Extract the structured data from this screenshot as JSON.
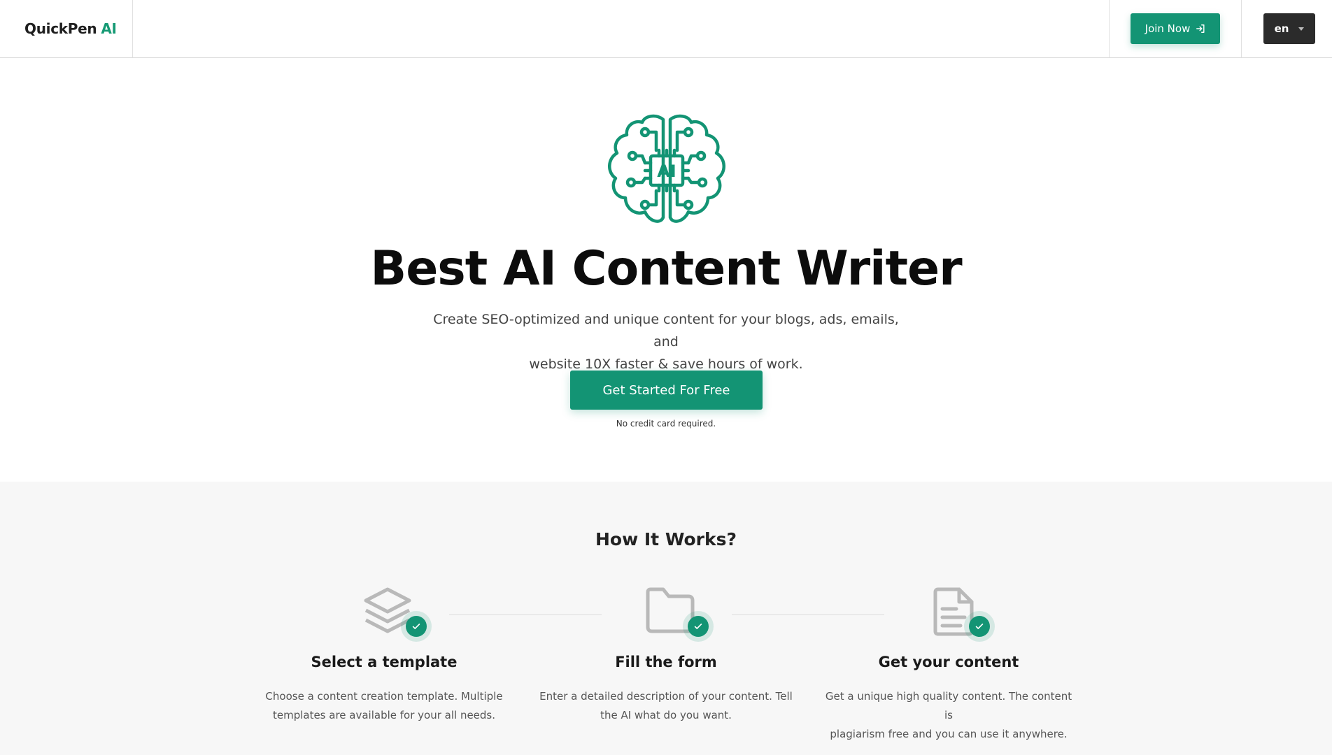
{
  "brand": {
    "name": "QuickPen",
    "accent": "AI"
  },
  "header": {
    "join_label": "Join Now",
    "lang_label": "en"
  },
  "hero": {
    "logo_text": "AI",
    "title": "Best AI Content Writer",
    "subtitle_line1": "Create SEO-optimized and unique content for your blogs, ads, emails, and",
    "subtitle_line2": "website 10X faster & save hours of work.",
    "cta_label": "Get Started For Free",
    "note": "No credit card required."
  },
  "how": {
    "title": "How It Works?",
    "steps": [
      {
        "icon": "layers-icon",
        "title": "Select a template",
        "desc_line1": "Choose a content creation template. Multiple",
        "desc_line2": "templates are available for your all needs."
      },
      {
        "icon": "folder-icon",
        "title": "Fill the form",
        "desc_line1": "Enter a detailed description of your content. Tell",
        "desc_line2": "the AI what do you want."
      },
      {
        "icon": "document-icon",
        "title": "Get your content",
        "desc_line1": "Get a unique high quality content. The content is",
        "desc_line2": "plagiarism free and you can use it anywhere."
      }
    ]
  },
  "colors": {
    "accent": "#139474",
    "dark": "#2b2b2b",
    "section_bg": "#f7f7f7"
  }
}
